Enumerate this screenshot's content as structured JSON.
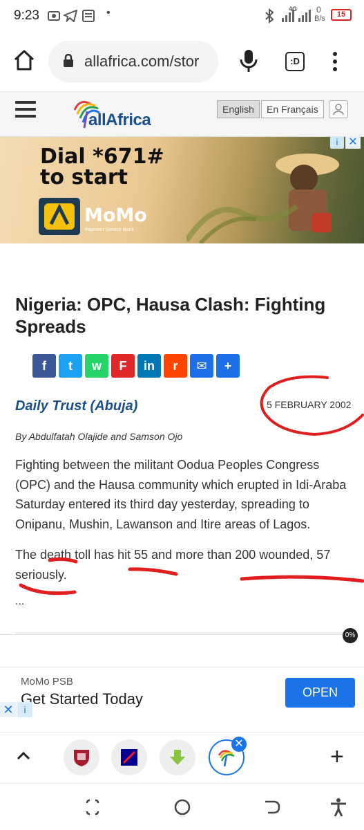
{
  "statusbar": {
    "time": "9:23",
    "data_speed": "0",
    "data_unit": "B/s",
    "network": "4G",
    "battery": "15"
  },
  "browser": {
    "url": "allafrica.com/stor",
    "tabs_label": ":D"
  },
  "site": {
    "logo_text": "allAfrica",
    "lang_english": "English",
    "lang_french": "En Français"
  },
  "top_ad": {
    "headline_line1": "Dial *671#",
    "headline_line2": "to start",
    "brand": "MoMo",
    "brand_sub": "Payment Service Bank",
    "info_icon": "i",
    "close_icon": "✕"
  },
  "article": {
    "title": "Nigeria: OPC, Hausa Clash: Fighting Spreads",
    "source": "Daily Trust (Abuja)",
    "date": "5 FEBRUARY 2002",
    "byline": "By Abdulfatah Olajide and Samson Ojo",
    "paragraph1": "Fighting between the militant Oodua Peoples Congress (OPC) and the Hausa community which erupted in Idi-Araba Saturday entered its third day yesterday, spreading to Onipanu, Mushin, Lawanson and Itire areas of Lagos.",
    "paragraph2": "The death toll has hit 55 and more than 200 wounded, 57 seriously.",
    "ellipsis": "...",
    "scroll_badge": "0%"
  },
  "share": [
    {
      "name": "facebook",
      "glyph": "f",
      "color": "#3b5998"
    },
    {
      "name": "twitter",
      "glyph": "t",
      "color": "#1da1f2"
    },
    {
      "name": "whatsapp",
      "glyph": "w",
      "color": "#25d366"
    },
    {
      "name": "flipboard",
      "glyph": "F",
      "color": "#e12828"
    },
    {
      "name": "linkedin",
      "glyph": "in",
      "color": "#0077b5"
    },
    {
      "name": "reddit",
      "glyph": "r",
      "color": "#ff4500"
    },
    {
      "name": "email",
      "glyph": "✉",
      "color": "#1e6ee8"
    },
    {
      "name": "share-more",
      "glyph": "+",
      "color": "#1e6ee8"
    }
  ],
  "bottom_ad": {
    "advertiser": "MoMo PSB",
    "headline": "Get Started Today",
    "button": "OPEN",
    "close_icon": "✕",
    "info_icon": "i"
  },
  "tabstrip": {
    "close_icon": "✕",
    "new_tab": "+"
  },
  "colors": {
    "accent": "#1a73e8",
    "brand_blue": "#1a4f8b",
    "annotation_red": "#e01e1e"
  }
}
